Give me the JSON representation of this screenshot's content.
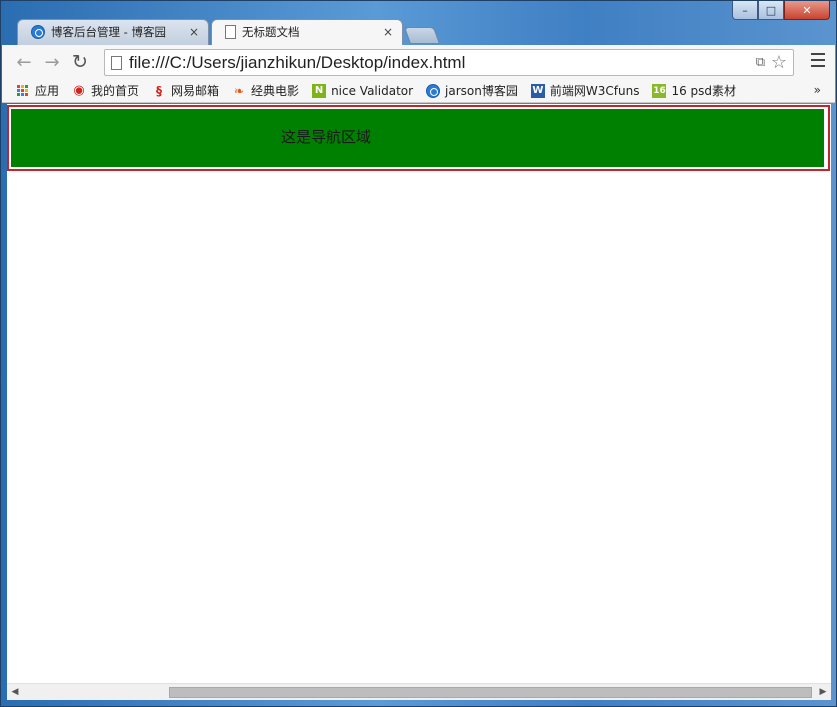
{
  "tabs": [
    {
      "title": "博客后台管理 - 博客园",
      "icon": "cnblogs-icon",
      "close": "×"
    },
    {
      "title": "无标题文档",
      "icon": "page-icon",
      "close": "×"
    }
  ],
  "window_controls": {
    "minimize": "–",
    "maximize": "□",
    "close": "✕"
  },
  "toolbar": {
    "back": "←",
    "forward": "→",
    "reload": "↻",
    "url": "file:///C:/Users/jianzhikun/Desktop/index.html",
    "translate_icon": "⧉",
    "star": "☆"
  },
  "bookmarks": [
    {
      "label": "应用",
      "icon": "apps-icon"
    },
    {
      "label": "我的首页",
      "icon": "weibo-icon"
    },
    {
      "label": "网易邮箱",
      "icon": "netease-icon"
    },
    {
      "label": "经典电影",
      "icon": "leaf-icon"
    },
    {
      "label": "nice Validator",
      "icon": "n-icon"
    },
    {
      "label": "jarson博客园",
      "icon": "cnblogs-icon"
    },
    {
      "label": "前端网W3Cfuns",
      "icon": "w-icon"
    },
    {
      "label": "16 psd素材",
      "icon": "16-icon"
    }
  ],
  "bookmarks_more": "»",
  "page": {
    "nav_text": "这是导航区域"
  },
  "scrollbar": {
    "left": "◀",
    "right": "▶"
  },
  "colors": {
    "nav_background": "#008000",
    "nav_border": "#c0272d"
  }
}
